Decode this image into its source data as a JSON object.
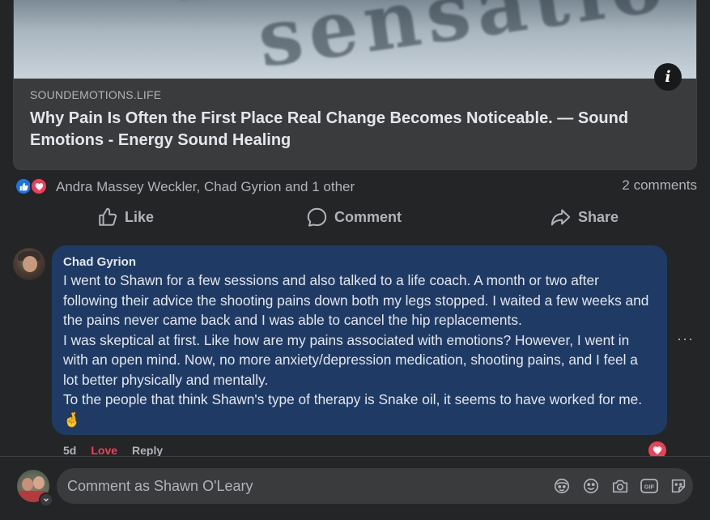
{
  "link_preview": {
    "domain": "SOUNDEMOTIONS.LIFE",
    "title": "Why Pain Is Often the First Place Real Change Becomes Noticeable. — Sound Emotions - Energy Sound Healing",
    "info_icon": "info-icon"
  },
  "reactions": {
    "icons": [
      "like-reaction-icon",
      "love-reaction-icon"
    ],
    "reactors_text": "Andra Massey Weckler, Chad Gyrion and 1 other",
    "comments_count": "2 comments"
  },
  "actions": {
    "like_label": "Like",
    "comment_label": "Comment",
    "share_label": "Share"
  },
  "comment": {
    "author": "Chad Gyrion",
    "text": "I went to Shawn for a few sessions and also talked to a life coach. A month or two after following their advice the shooting pains down both my legs stopped. I waited a few weeks and the pains never came back and I was able to cancel the hip replacements.\nI was skeptical at first. Like how are my pains associated with emotions? However, I went in with an open mind. Now, no more anxiety/depression medication, shooting pains, and I feel a lot better physically and mentally.\nTo the people that think Shawn's type of therapy is Snake oil, it seems to have worked for me. 🤞",
    "age": "5d",
    "love_label": "Love",
    "reply_label": "Reply",
    "more_label": "···",
    "reaction_icon": "love-reaction-icon"
  },
  "composer": {
    "placeholder": "Comment as Shawn O'Leary",
    "icons": [
      "avatar-sticker-icon",
      "emoji-icon",
      "camera-icon",
      "gif-icon",
      "sticker-icon"
    ],
    "gif_label": "GIF"
  },
  "colors": {
    "background": "#242526",
    "comment_bubble": "#1f3b65",
    "like_blue": "#1b74e4",
    "love_red": "#f33e58",
    "secondary_text": "#b0b3b8"
  }
}
